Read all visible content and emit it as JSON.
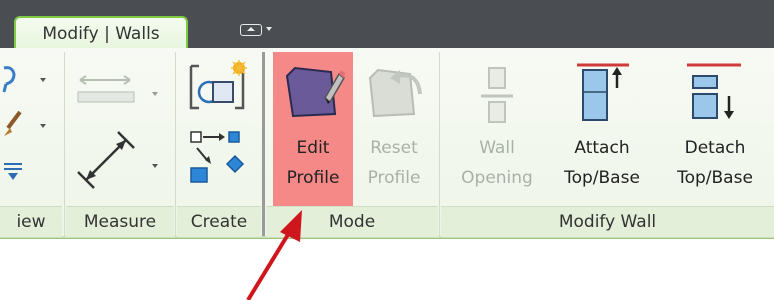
{
  "tab": {
    "active_label": "Modify | Walls"
  },
  "panels": {
    "view": {
      "label": "iew"
    },
    "measure": {
      "label": "Measure"
    },
    "create": {
      "label": "Create"
    },
    "mode": {
      "label": "Mode",
      "edit_profile": {
        "line1": "Edit",
        "line2": "Profile"
      },
      "reset_profile": {
        "line1": "Reset",
        "line2": "Profile"
      }
    },
    "modify_wall": {
      "label": "Modify Wall",
      "wall_opening": {
        "line1": "Wall",
        "line2": "Opening"
      },
      "attach": {
        "line1": "Attach",
        "line2": "Top/Base"
      },
      "detach": {
        "line1": "Detach",
        "line2": "Top/Base"
      }
    }
  },
  "icons": {
    "quick_access": "dropdown-panel-icon",
    "view_tools": [
      "magnifier-icon",
      "paint-brush-icon",
      "hide-element-icon"
    ],
    "measure": [
      "aligned-dimension-icon",
      "measure-diagonal-icon"
    ],
    "create": [
      "create-similar-icon",
      "create-group-icon"
    ],
    "mode": [
      "edit-profile-icon",
      "reset-profile-icon"
    ],
    "modify_wall": [
      "wall-opening-icon",
      "attach-top-base-icon",
      "detach-top-base-icon"
    ],
    "annotation": "red-arrow-icon"
  },
  "colors": {
    "tabbar": "#4a4d52",
    "active_tab_border": "#7fca45",
    "highlight": "#f47f7f",
    "annotation_arrow": "#d0161d"
  }
}
